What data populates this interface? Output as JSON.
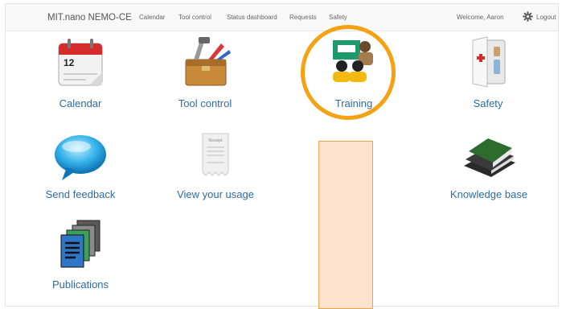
{
  "navbar": {
    "brand": "MIT.nano NEMO-CE",
    "links": [
      "Calendar",
      "Tool control",
      "Status dashboard",
      "Requests",
      "Safety"
    ],
    "welcome": "Welcome, Aaron",
    "logout": "Logout"
  },
  "tiles": {
    "calendar": {
      "label": "Calendar",
      "icon_text": "12"
    },
    "tool_control": {
      "label": "Tool control"
    },
    "training": {
      "label": "Training"
    },
    "safety": {
      "label": "Safety"
    },
    "send_feedback": {
      "label": "Send feedback"
    },
    "view_usage": {
      "label": "View your usage",
      "receipt_title": "Receipt"
    },
    "knowledge_base": {
      "label": "Knowledge base"
    },
    "publications": {
      "label": "Publications"
    }
  },
  "colors": {
    "link": "#2d6ca2",
    "highlight": "#f5a114",
    "overlay_fill": "#fde3cd",
    "overlay_border": "#f3a24a"
  }
}
